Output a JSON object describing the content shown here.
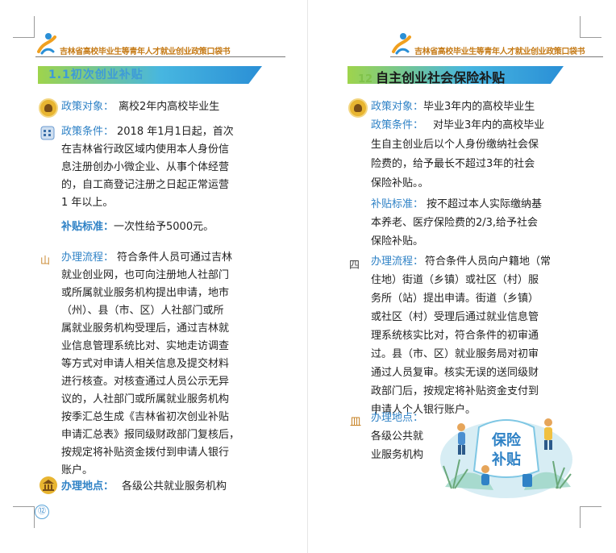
{
  "header": {
    "title": "吉林省高校毕业生等青年人才就业创业政策口袋书"
  },
  "left": {
    "section_title": "1.1初次创业补贴",
    "policy_target_label": "政策对象：",
    "policy_target": "离校2年内高校毕业生",
    "condition_label": "政策条件：",
    "condition_lines": [
      "2018 年1月1日起，首次",
      "在吉林省行政区域内使用本人身份信",
      "息注册创办小微企业、从事个体经营",
      "的，自工商登记注册之日起正常运营",
      "1 年以上。"
    ],
    "subsidy_label": "补贴标准：",
    "subsidy": "一次性给予5000元。",
    "process_marker": "山",
    "process_label": "办理流程：",
    "process_lines": [
      "符合条件人员可通过吉林",
      "就业创业网，也可向注册地人社部门",
      "或所属就业服务机构提出申请，地市",
      "（州）、县（市、区）人社部门或所",
      "属就业服务机构受理后，通过吉林就",
      "业信息管理系统比对、实地走访调查",
      "等方式对申请人相关信息及提交材料",
      "进行核查。对核查通过人员公示无异",
      "议的，人社部门或所属就业服务机构",
      "按季汇总生成《吉林省初次创业补贴",
      "申请汇总表》报同级财政部门复核后，",
      "按规定将补贴资金拨付到申请人银行",
      "账户。"
    ],
    "location_label": "办理地点：",
    "location": "各级公共就业服务机构",
    "page_number": "⑫"
  },
  "right": {
    "section_number": "12",
    "section_title": "自主创业社会保险补贴",
    "policy_target_label": "政策对象：",
    "policy_target": "毕业3年内的高校毕业生",
    "condition_label": "政策条件：",
    "condition_lines": [
      "对毕业3年内的高校毕业",
      "生自主创业后以个人身份缴纳社会保",
      "险费的，给予最长不超过3年的社会",
      "保险补贴。。"
    ],
    "subsidy_label": "补贴标准：",
    "subsidy_lines": [
      "按不超过本人实际缴纳基",
      "本养老、医疗保险费的2/3,给予社会",
      "保险补贴。"
    ],
    "process_marker": "四",
    "process_label": "办理流程：",
    "process_lines": [
      "符合条件人员向户籍地（常",
      "住地）街道（乡镇）或社区（村）服",
      "务所（站）提出申请。街道（乡镇）",
      "或社区（村）受理后通过就业信息管",
      "理系统核实比对，符合条件的初审通",
      "过。县（市、区）就业服务局对初审",
      "通过人员复审。核实无误的送同级财",
      "政部门后，按规定将补贴资金支付到",
      "申请人个人银行账户。"
    ],
    "location_marker": "皿",
    "location_label": "办理地点：",
    "location_lines": [
      "各级公共就",
      "业服务机构"
    ],
    "illustration_text_1": "保险",
    "illustration_text_2": "补贴"
  },
  "colors": {
    "accent_blue": "#2f82c6",
    "header_orange": "#c57a16",
    "bar_green": "#9ed44c",
    "bar_blue": "#2a8fd6"
  }
}
